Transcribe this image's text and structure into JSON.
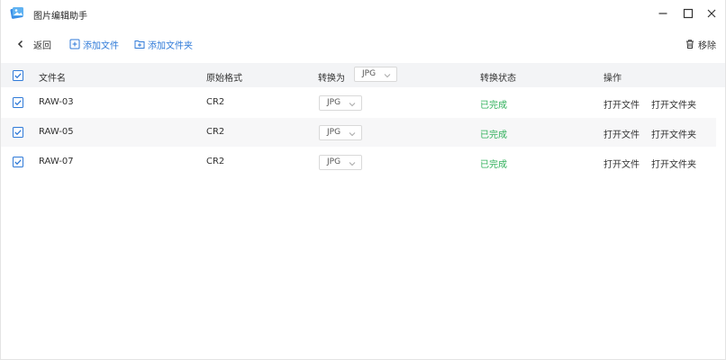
{
  "window": {
    "title": "图片编辑助手",
    "icon": "picture-book-icon",
    "controls": [
      "minimize-icon",
      "maximize-icon",
      "close-icon"
    ]
  },
  "toolbar": {
    "back_label": "返回",
    "add_file_label": "添加文件",
    "add_folder_label": "添加文件夹",
    "remove_label": "移除"
  },
  "table": {
    "headers": {
      "name": "文件名",
      "format": "原始格式",
      "convert_to": "转换为",
      "status": "转换状态",
      "actions": "操作"
    },
    "global_format": "JPG",
    "rows": [
      {
        "name": "RAW-03",
        "format": "CR2",
        "target": "JPG",
        "status": "已完成",
        "open_file": "打开文件",
        "open_folder": "打开文件夹"
      },
      {
        "name": "RAW-05",
        "format": "CR2",
        "target": "JPG",
        "status": "已完成",
        "open_file": "打开文件",
        "open_folder": "打开文件夹"
      },
      {
        "name": "RAW-07",
        "format": "CR2",
        "target": "JPG",
        "status": "已完成",
        "open_file": "打开文件",
        "open_folder": "打开文件夹"
      }
    ]
  },
  "colors": {
    "accent": "#2f7ad8",
    "success": "#2fb05a",
    "checkbox": "#2f7ad8"
  }
}
